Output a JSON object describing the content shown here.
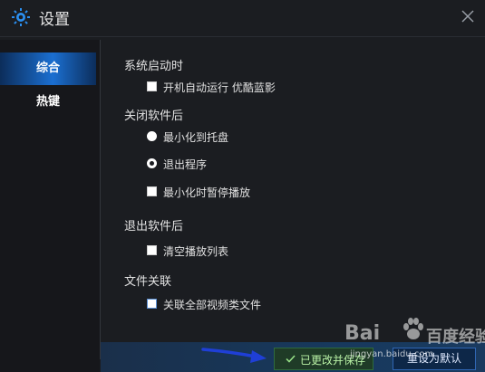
{
  "window": {
    "title": "设置",
    "icon": "gear-icon",
    "close_icon": "close-icon"
  },
  "sidebar": {
    "items": [
      {
        "label": "综合",
        "active": true
      },
      {
        "label": "热键",
        "active": false
      }
    ]
  },
  "sections": {
    "startup": {
      "title": "系统启动时",
      "options": [
        {
          "label": "开机自动运行 优酷蓝影",
          "type": "checkbox",
          "checked": false
        }
      ]
    },
    "close": {
      "title": "关闭软件后",
      "options": [
        {
          "label": "最小化到托盘",
          "type": "radio",
          "checked": false
        },
        {
          "label": "退出程序",
          "type": "radio",
          "checked": true
        },
        {
          "label": "最小化时暂停播放",
          "type": "checkbox",
          "checked": false
        }
      ]
    },
    "exit": {
      "title": "退出软件后",
      "options": [
        {
          "label": "清空播放列表",
          "type": "checkbox",
          "checked": false
        }
      ]
    },
    "assoc": {
      "title": "文件关联",
      "options": [
        {
          "label": "关联全部视频类文件",
          "type": "checkbox",
          "checked": false
        }
      ]
    }
  },
  "footer": {
    "saved_message": "已更改并保存",
    "saved_icon": "check-icon",
    "reset_button": "重设为默认"
  },
  "watermark": {
    "brand_left": "Bai",
    "brand_right": "百度",
    "sub": "经验",
    "url": "jingyan.baidu.com"
  },
  "colors": {
    "accent": "#1b6fd1",
    "background": "#1b1d21",
    "success_text": "#b9f2a6",
    "annotation_arrow": "#1f3fd6"
  }
}
